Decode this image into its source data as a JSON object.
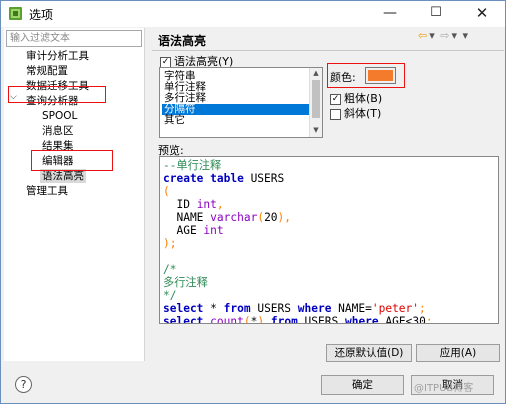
{
  "window": {
    "title": "选项",
    "min": "—",
    "max": "☐",
    "close": "✕"
  },
  "sidebar": {
    "filter_placeholder": "输入过滤文本",
    "items": [
      {
        "label": "审计分析工具",
        "level": 0
      },
      {
        "label": "常规配置",
        "level": 0
      },
      {
        "label": "数据迁移工具",
        "level": 0
      },
      {
        "label": "查询分析器",
        "level": 0,
        "expanded": true
      },
      {
        "label": "SPOOL",
        "level": 1
      },
      {
        "label": "消息区",
        "level": 1
      },
      {
        "label": "结果集",
        "level": 1
      },
      {
        "label": "编辑器",
        "level": 1
      },
      {
        "label": "语法高亮",
        "level": 1,
        "selected": true
      },
      {
        "label": "管理工具",
        "level": 0
      }
    ],
    "expand_glyph": "⌵"
  },
  "panel": {
    "title": "语法高亮",
    "nav": {
      "back": "⇦",
      "back_menu": "▾",
      "forward": "⇨",
      "forward_menu": "▾",
      "menu": "▾"
    },
    "enable_label": "语法高亮(Y)",
    "enable_checked": true,
    "categories": [
      "字符串",
      "单行注释",
      "多行注释",
      "分隔符",
      "其它"
    ],
    "selected_category": "分隔符",
    "color_label": "颜色:",
    "color_value": "#f47a2c",
    "bold_label": "粗体(B)",
    "bold_checked": true,
    "italic_label": "斜体(T)",
    "italic_checked": false,
    "preview_label": "预览:",
    "preview_lines": [
      "--单行注释",
      "create table USERS",
      "(",
      "  ID int,",
      "  NAME varchar(20),",
      "  AGE int",
      ");",
      "",
      "/*",
      "多行注释",
      "*/",
      "select * from USERS where NAME='peter';",
      "select count(*) from USERS where AGE<30;"
    ],
    "restore_button": "还原默认值(D)",
    "apply_button": "应用(A)"
  },
  "footer": {
    "help": "?",
    "ok_button": "确定",
    "cancel_button": "取消",
    "watermark": "@ITPUB博客"
  },
  "colors": {
    "keyword": "#0000c0",
    "comment": "#2e8b57",
    "delimiter": "#ff8000",
    "type": "#8d00c0",
    "string": "#e00000",
    "selection": "#0078d7",
    "highlight_box": "#e11111"
  }
}
